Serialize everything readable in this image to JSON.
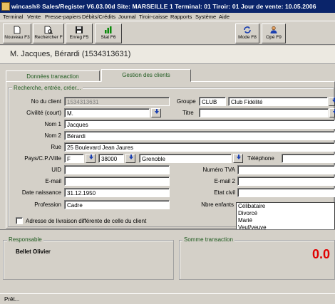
{
  "window": {
    "title": "wincash® Sales/Register V6.03.00d  Site: MARSEILLE 1   Terminal: 01   Tiroir: 01   Jour de vente: 10.05.2006"
  },
  "menu": [
    "Terminal",
    "Vente",
    "Presse-papiers",
    "Débits/Crédits",
    "Journal",
    "Tiroir-caisse",
    "Rapports",
    "Système",
    "Aide"
  ],
  "toolbar": {
    "new_label": "Nouveau F3",
    "search_label": "Rechercher F",
    "save_label": "Enreg F5",
    "stat_label": "Stat F6",
    "mode_label": "Mode F8",
    "ope_label": "Opé F9"
  },
  "customer_header": "M. Jacques, Bérardi (1534313631)",
  "tabs": [
    "Données transaction",
    "Gestion des clients"
  ],
  "form": {
    "group_title": "Recherche, entrée, créer...",
    "labels": {
      "client_no": "No du client",
      "civilite": "Civilité (court)",
      "nom1": "Nom 1",
      "nom2": "Nom 2",
      "rue": "Rue",
      "pays": "Pays/C.P./Ville",
      "uid": "UID",
      "email": "E-mail",
      "date_naissance": "Date naissance",
      "profession": "Profession",
      "groupe": "Groupe",
      "titre": "Titre",
      "telephone": "Téléphone",
      "numero_tva": "Numéro TVA",
      "email2": "E-mail 2",
      "etat_civil": "Etat civil",
      "nbre_enfants": "Nbre enfants",
      "livraison": "Adresse de livraison différente de celle du client"
    },
    "values": {
      "client_no": "1534313631",
      "civilite": "M.",
      "nom1": "Jacques",
      "nom2": "Bérardi",
      "rue": "25 Boulevard Jean Jaures",
      "pays": "F",
      "cp": "38000",
      "ville": "Grenoble",
      "uid": "",
      "email": "",
      "date_naissance": "31.12.1950",
      "profession": "Cadre",
      "groupe_code": "CLUB",
      "groupe_name": "Club Fidélité",
      "titre": "",
      "telephone": "",
      "numero_tva": "",
      "email2": "",
      "etat_civil": ""
    },
    "etat_civil_options": [
      "Célibataire",
      "Divorcé",
      "Marié",
      "Veuf/veuve"
    ]
  },
  "bottom": {
    "responsable_title": "Responsable",
    "responsable_name": "Bellet Olivier",
    "somme_title": "Somme transaction",
    "somme_value": "0.0"
  },
  "status": "Prêt..."
}
